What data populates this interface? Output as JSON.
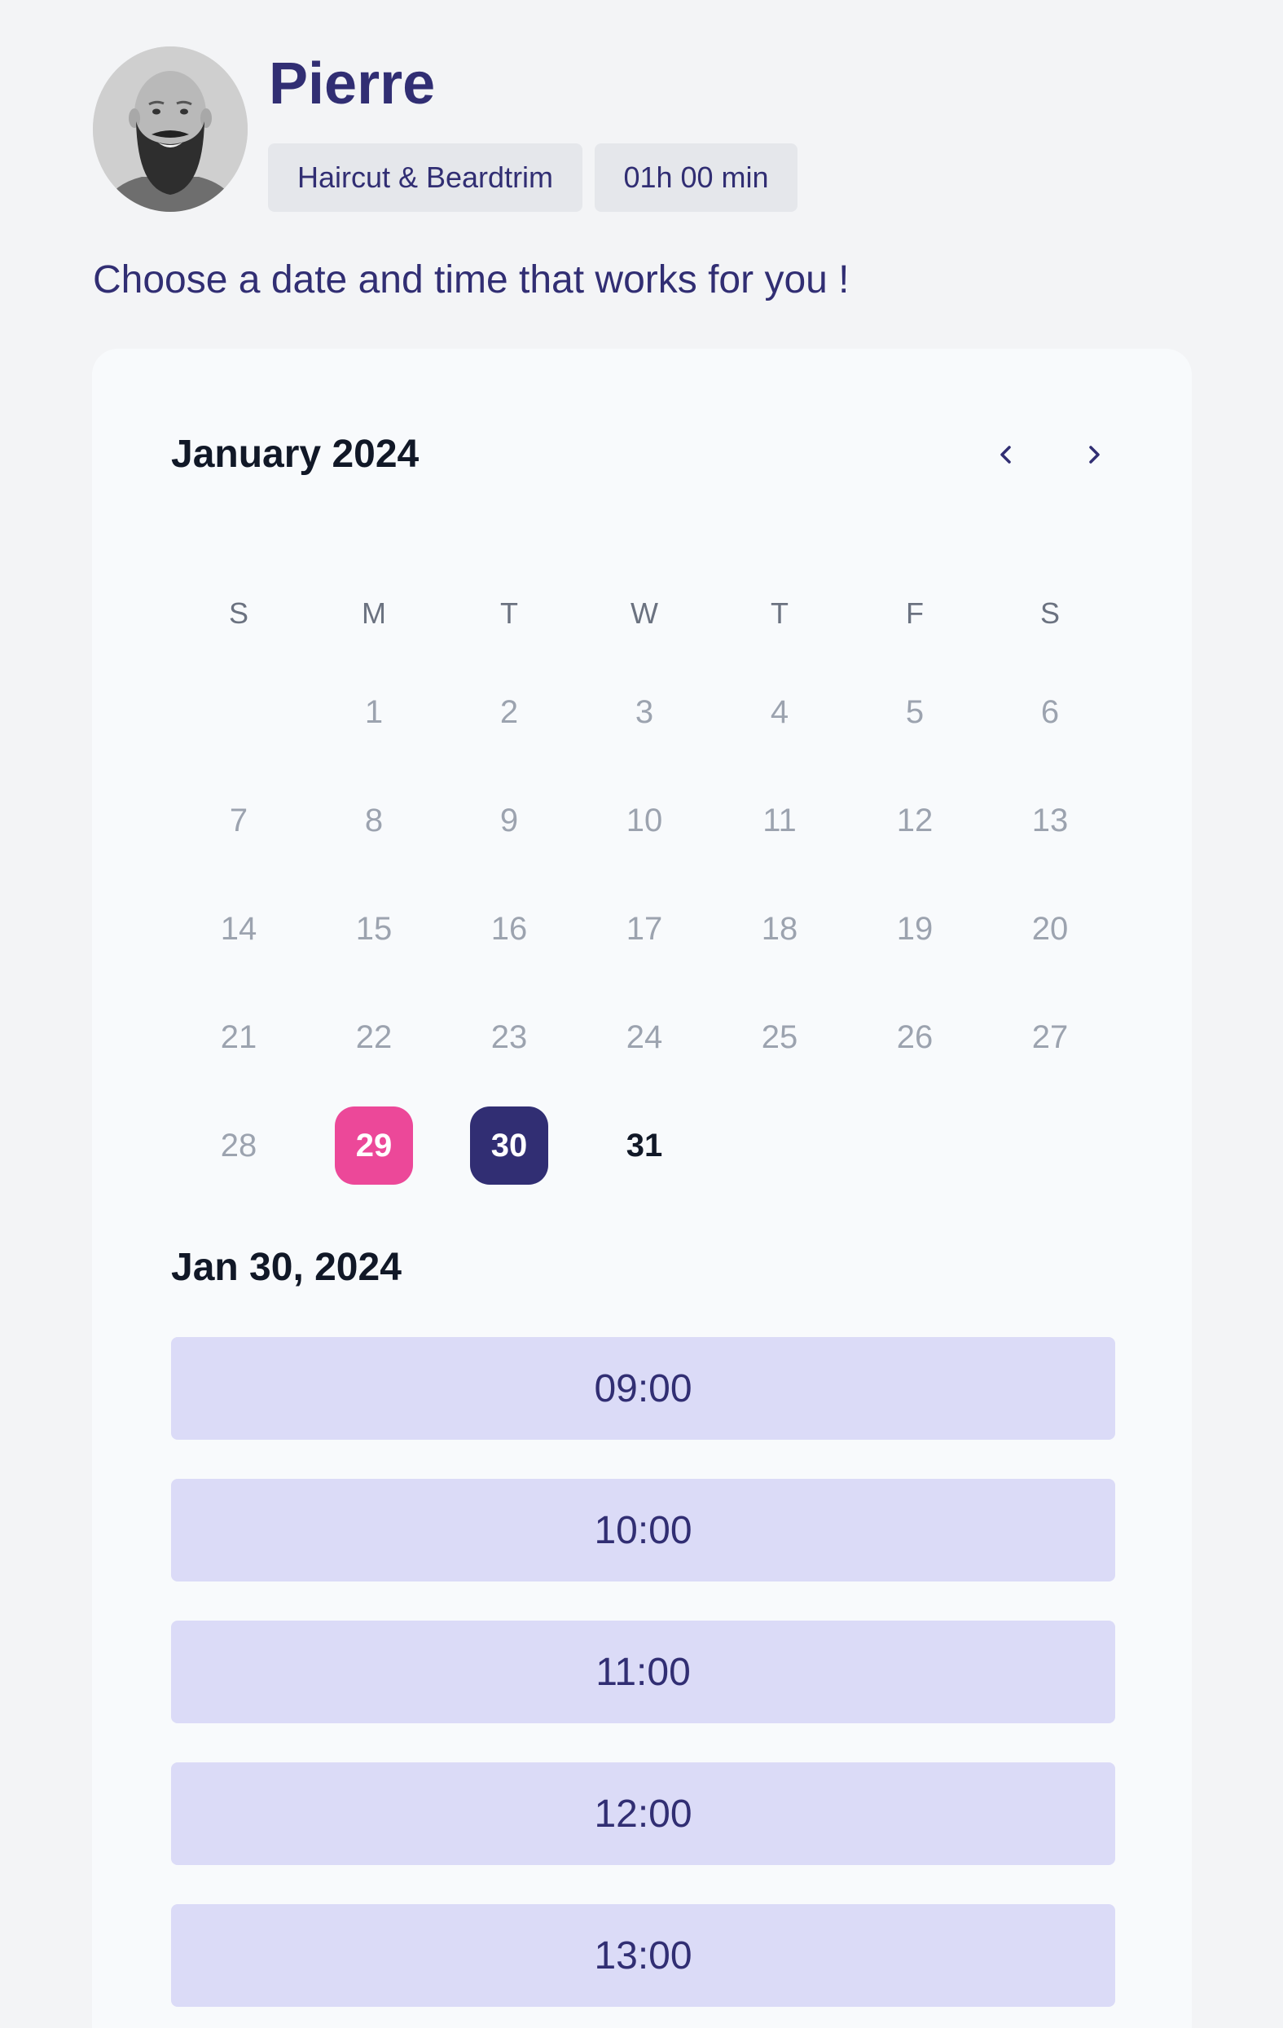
{
  "provider": {
    "name": "Pierre",
    "service": "Haircut & Beardtrim",
    "duration": "01h 00 min"
  },
  "intro": "Choose a date and time that works for you !",
  "calendar": {
    "month_label": "January 2024",
    "nav": {
      "prev_icon": "chevron-left-icon",
      "next_icon": "chevron-right-icon"
    },
    "weekdays": [
      "S",
      "M",
      "T",
      "W",
      "T",
      "F",
      "S"
    ],
    "first_weekday_index": 1,
    "days_in_month": 31,
    "today": 29,
    "selected": 30,
    "available": [
      31
    ]
  },
  "selected_date_label": "Jan 30, 2024",
  "time_slots": [
    "09:00",
    "10:00",
    "11:00",
    "12:00",
    "13:00"
  ],
  "colors": {
    "brand": "#312e73",
    "today": "#ec4899",
    "slot_bg": "#dbdbf7"
  }
}
